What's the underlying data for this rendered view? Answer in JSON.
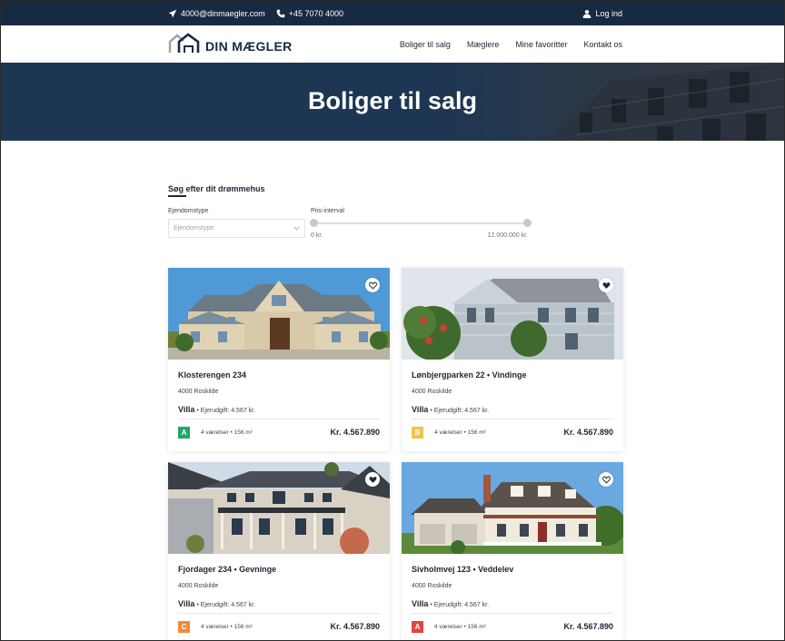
{
  "topbar": {
    "email": "4000@dinmaegler.com",
    "phone": "+45 7070 4000",
    "login": "Log ind"
  },
  "header": {
    "logo_text": "DIN MÆGLER",
    "nav": [
      "Boliger til salg",
      "Mæglere",
      "Mine favoritter",
      "Kontakt os"
    ]
  },
  "hero": {
    "title": "Boliger til salg"
  },
  "search": {
    "title": "Søg efter dit drømmehus",
    "property_type_label": "Ejendomstype",
    "property_type_placeholder": "Ejendomstype",
    "price_label": "Pris-interval",
    "price_min": "0 kr.",
    "price_max": "12.000.000 kr."
  },
  "listings": [
    {
      "title": "Klosterengen 234",
      "city": "4000 Roskilde",
      "type": "Villa",
      "owner_cost": "• Ejerudgift: 4.567 kr.",
      "energy": "A",
      "energy_color": "#1fa76b",
      "rooms": "4 værelser • 156 m²",
      "price": "Kr. 4.567.890",
      "favorited": false
    },
    {
      "title": "Lønbjergparken 22 • Vindinge",
      "city": "4000 Roskilde",
      "type": "Villa",
      "owner_cost": "• Ejerudgift: 4.567 kr.",
      "energy": "B",
      "energy_color": "#f2c447",
      "rooms": "4 værelser • 156 m²",
      "price": "Kr. 4.567.890",
      "favorited": true
    },
    {
      "title": "Fjordager 234 • Gevninge",
      "city": "4000 Roskilde",
      "type": "Villa",
      "owner_cost": "• Ejerudgift: 4.567 kr.",
      "energy": "C",
      "energy_color": "#f28c38",
      "rooms": "4 værelser • 156 m²",
      "price": "Kr. 4.567.890",
      "favorited": true
    },
    {
      "title": "Sivholmvej 123 • Veddelev",
      "city": "4000 Roskilde",
      "type": "Villa",
      "owner_cost": "• Ejerudgift: 4.567 kr.",
      "energy": "A",
      "energy_color": "#e0473f",
      "rooms": "4 værelser • 156 m²",
      "price": "Kr. 4.567.890",
      "favorited": false
    }
  ]
}
